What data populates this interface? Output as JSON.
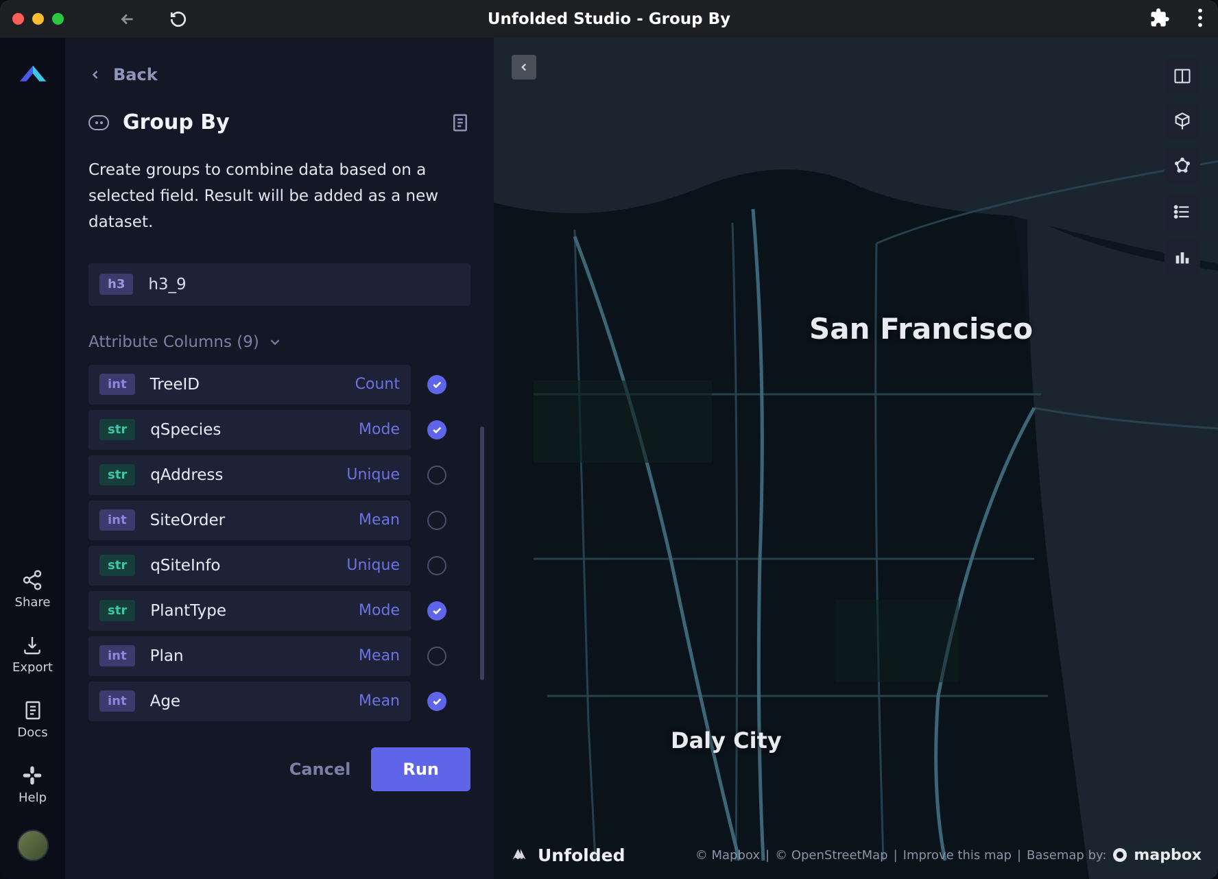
{
  "window": {
    "title": "Unfolded Studio - Group By"
  },
  "leftRail": {
    "share": "Share",
    "export": "Export",
    "docs": "Docs",
    "help": "Help"
  },
  "panel": {
    "back": "Back",
    "title": "Group By",
    "description": "Create groups to combine data based on a selected field. Result will be added as a new dataset.",
    "field": {
      "type": "h3",
      "name": "h3_9"
    },
    "attrHeader": "Attribute Columns (9)",
    "attributes": [
      {
        "type": "int",
        "name": "TreeID",
        "agg": "Count",
        "checked": true
      },
      {
        "type": "str",
        "name": "qSpecies",
        "agg": "Mode",
        "checked": true
      },
      {
        "type": "str",
        "name": "qAddress",
        "agg": "Unique",
        "checked": false
      },
      {
        "type": "int",
        "name": "SiteOrder",
        "agg": "Mean",
        "checked": false
      },
      {
        "type": "str",
        "name": "qSiteInfo",
        "agg": "Unique",
        "checked": false
      },
      {
        "type": "str",
        "name": "PlantType",
        "agg": "Mode",
        "checked": true
      },
      {
        "type": "int",
        "name": "Plan",
        "agg": "Mean",
        "checked": false
      },
      {
        "type": "int",
        "name": "Age",
        "agg": "Mean",
        "checked": true
      }
    ],
    "cancel": "Cancel",
    "run": "Run"
  },
  "map": {
    "labels": {
      "sf": "San Francisco",
      "daly": "Daly City"
    },
    "brand": "Unfolded",
    "attribution": {
      "mapbox": "© Mapbox",
      "osm": "© OpenStreetMap",
      "improve": "Improve this map",
      "basemap": "Basemap by:",
      "mapboxName": "mapbox"
    }
  }
}
